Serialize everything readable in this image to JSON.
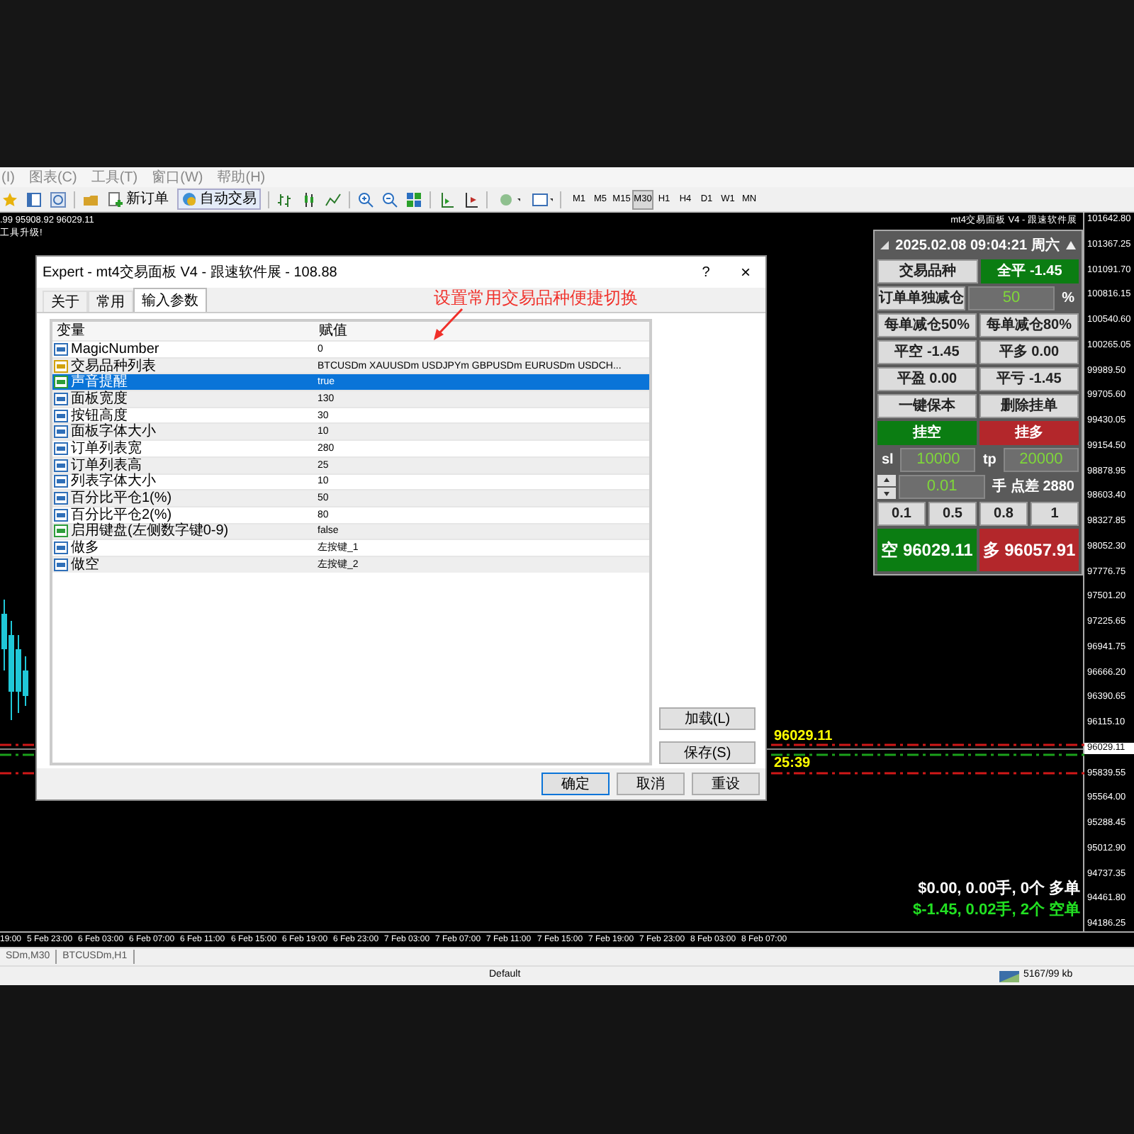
{
  "menu": [
    "(I)",
    "图表(C)",
    "工具(T)",
    "窗口(W)",
    "帮助(H)"
  ],
  "toolbar": {
    "new_order": "新订单",
    "auto_trade": "自动交易",
    "timeframes": [
      {
        "label": "M1",
        "selected": false
      },
      {
        "label": "M5",
        "selected": false
      },
      {
        "label": "M15",
        "selected": false
      },
      {
        "label": "M30",
        "selected": true
      },
      {
        "label": "H1",
        "selected": false
      },
      {
        "label": "H4",
        "selected": false
      },
      {
        "label": "D1",
        "selected": false
      },
      {
        "label": "W1",
        "selected": false
      },
      {
        "label": "MN",
        "selected": false
      }
    ]
  },
  "chart": {
    "info_lines": [
      ".99 95908.92 96029.11",
      "工具升级!"
    ],
    "ea_title": "mt4交易面板 V4 - 跟速软件展",
    "price_labels": [
      {
        "kind": "tick",
        "text": "101642.80"
      },
      {
        "kind": "tick",
        "text": "101367.25"
      },
      {
        "kind": "tick",
        "text": "101091.70"
      },
      {
        "kind": "tick",
        "text": "100816.15"
      },
      {
        "kind": "tick",
        "text": "100540.60"
      },
      {
        "kind": "tick",
        "text": "100265.05"
      },
      {
        "kind": "tick",
        "text": "99989.50"
      },
      {
        "kind": "tick",
        "text": "99705.60"
      },
      {
        "kind": "tick",
        "text": "99430.05"
      },
      {
        "kind": "tick",
        "text": "99154.50"
      },
      {
        "kind": "tick",
        "text": "98878.95"
      },
      {
        "kind": "tick",
        "text": "98603.40"
      },
      {
        "kind": "tick",
        "text": "98327.85"
      },
      {
        "kind": "tick",
        "text": "98052.30"
      },
      {
        "kind": "tick",
        "text": "97776.75"
      },
      {
        "kind": "tick",
        "text": "97501.20"
      },
      {
        "kind": "tick",
        "text": "97225.65"
      },
      {
        "kind": "tick",
        "text": "96941.75"
      },
      {
        "kind": "tick",
        "text": "96666.20"
      },
      {
        "kind": "tick",
        "text": "96390.65"
      },
      {
        "kind": "tick",
        "text": "96115.10"
      },
      {
        "kind": "current",
        "text": "96029.11"
      },
      {
        "kind": "tick",
        "text": "95839.55"
      },
      {
        "kind": "tick",
        "text": "95564.00"
      },
      {
        "kind": "tick",
        "text": "95288.45"
      },
      {
        "kind": "tick",
        "text": "95012.90"
      },
      {
        "kind": "tick",
        "text": "94737.35"
      },
      {
        "kind": "tick",
        "text": "94461.80"
      },
      {
        "kind": "tick",
        "text": "94186.25"
      }
    ],
    "current_price": "96029.11",
    "countdown": "25:39",
    "long_summary": "$0.00, 0.00手, 0个 多单",
    "short_summary": "$-1.45, 0.02手, 2个 空单",
    "time_labels": [
      "19:00",
      "5 Feb 23:00",
      "6 Feb 03:00",
      "6 Feb 07:00",
      "6 Feb 11:00",
      "6 Feb 15:00",
      "6 Feb 19:00",
      "6 Feb 23:00",
      "7 Feb 03:00",
      "7 Feb 07:00",
      "7 Feb 11:00",
      "7 Feb 15:00",
      "7 Feb 19:00",
      "7 Feb 23:00",
      "8 Feb 03:00",
      "8 Feb 07:00"
    ]
  },
  "dialog": {
    "title": "Expert - mt4交易面板 V4 - 跟速软件展 - 108.88",
    "help": "?",
    "close": "×",
    "tabs": [
      {
        "label": "关于",
        "selected": false
      },
      {
        "label": "常用",
        "selected": false
      },
      {
        "label": "输入参数",
        "selected": true
      }
    ],
    "annotation": "设置常用交易品种便捷切换",
    "columns": [
      "变量",
      "赋值"
    ],
    "rows": [
      {
        "kind": "int",
        "name": "MagicNumber",
        "value": "0",
        "selected": false
      },
      {
        "kind": "string",
        "name": "交易品种列表",
        "value": "BTCUSDm XAUUSDm USDJPYm GBPUSDm EURUSDm USDCH...",
        "selected": false
      },
      {
        "kind": "bool",
        "name": "声音提醒",
        "value": "true",
        "selected": true
      },
      {
        "kind": "int",
        "name": "面板宽度",
        "value": "130",
        "selected": false
      },
      {
        "kind": "int",
        "name": "按钮高度",
        "value": "30",
        "selected": false
      },
      {
        "kind": "int",
        "name": "面板字体大小",
        "value": "10",
        "selected": false
      },
      {
        "kind": "int",
        "name": "订单列表宽",
        "value": "280",
        "selected": false
      },
      {
        "kind": "int",
        "name": "订单列表高",
        "value": "25",
        "selected": false
      },
      {
        "kind": "int",
        "name": "列表字体大小",
        "value": "10",
        "selected": false
      },
      {
        "kind": "int",
        "name": "百分比平仓1(%)",
        "value": "50",
        "selected": false
      },
      {
        "kind": "int",
        "name": "百分比平仓2(%)",
        "value": "80",
        "selected": false
      },
      {
        "kind": "bool",
        "name": "启用键盘(左侧数字键0-9)",
        "value": "false",
        "selected": false
      },
      {
        "kind": "int",
        "name": "做多",
        "value": "左按键_1",
        "selected": false
      },
      {
        "kind": "int",
        "name": "做空",
        "value": "左按键_2",
        "selected": false
      }
    ],
    "side_buttons": [
      "加载(L)",
      "保存(S)"
    ],
    "buttons": [
      {
        "label": "确定",
        "default": true
      },
      {
        "label": "取消",
        "default": false
      },
      {
        "label": "重设",
        "default": false
      }
    ]
  },
  "panel": {
    "date_time": "2025.02.08 09:04:21 周六",
    "rows": [
      [
        {
          "kind": "button",
          "text": "交易品种"
        },
        {
          "kind": "button",
          "text": "全平 -1.45",
          "color": "#0b7d12"
        }
      ],
      [
        {
          "kind": "button",
          "text": "订单单独减仓"
        },
        {
          "kind": "field",
          "text": "50"
        },
        {
          "kind": "label",
          "text": "%"
        }
      ],
      [
        {
          "kind": "button",
          "text": "每单减仓50%"
        },
        {
          "kind": "button",
          "text": "每单减仓80%"
        }
      ],
      [
        {
          "kind": "button",
          "text": "平空 -1.45"
        },
        {
          "kind": "button",
          "text": "平多 0.00"
        }
      ],
      [
        {
          "kind": "button",
          "text": "平盈 0.00"
        },
        {
          "kind": "button",
          "text": "平亏 -1.45"
        }
      ],
      [
        {
          "kind": "button",
          "text": "一键保本"
        },
        {
          "kind": "button",
          "text": "删除挂单"
        }
      ],
      [
        {
          "kind": "button",
          "text": "挂空",
          "color": "#0b7d12"
        },
        {
          "kind": "button",
          "text": "挂多",
          "color": "#b3272b"
        }
      ],
      [
        {
          "kind": "label",
          "text": "sl"
        },
        {
          "kind": "field",
          "text": "10000"
        },
        {
          "kind": "label",
          "text": "tp"
        },
        {
          "kind": "field",
          "text": "20000"
        }
      ],
      [
        {
          "kind": "spinner"
        },
        {
          "kind": "field",
          "text": "0.01"
        },
        {
          "kind": "label",
          "text": "手 点差 2880"
        }
      ],
      [
        {
          "kind": "button",
          "text": "0.1"
        },
        {
          "kind": "button",
          "text": "0.5"
        },
        {
          "kind": "button",
          "text": "0.8"
        },
        {
          "kind": "button",
          "text": "1"
        }
      ]
    ],
    "prices": [
      {
        "text": "空 96029.11",
        "color": "#0b7d12"
      },
      {
        "text": "多 96057.91",
        "color": "#b3272b"
      }
    ]
  },
  "chart_tabs": [
    "SDm,M30",
    "BTCUSDm,H1"
  ],
  "status_bar": {
    "profile": "Default",
    "traffic": "5167/99 kb"
  }
}
